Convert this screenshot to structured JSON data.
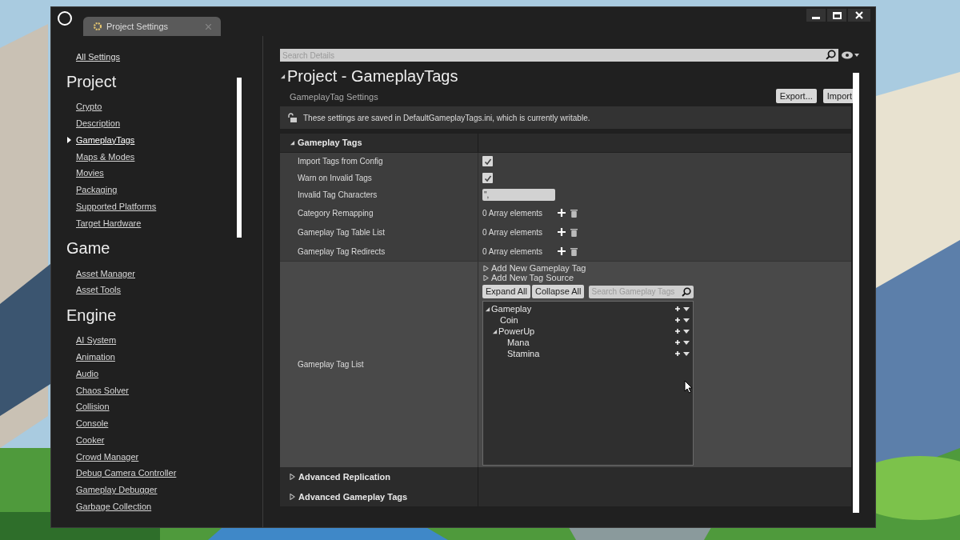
{
  "window": {
    "tab": "Project Settings"
  },
  "sidebar": {
    "all_settings": "All Settings",
    "sections": [
      {
        "title": "Project",
        "items": [
          {
            "label": "Crypto",
            "selected": false
          },
          {
            "label": "Description",
            "selected": false
          },
          {
            "label": "GameplayTags",
            "selected": true
          },
          {
            "label": "Maps & Modes",
            "selected": false
          },
          {
            "label": "Movies",
            "selected": false
          },
          {
            "label": "Packaging",
            "selected": false
          },
          {
            "label": "Supported Platforms",
            "selected": false
          },
          {
            "label": "Target Hardware",
            "selected": false
          }
        ]
      },
      {
        "title": "Game",
        "items": [
          {
            "label": "Asset Manager",
            "selected": false
          },
          {
            "label": "Asset Tools",
            "selected": false
          }
        ]
      },
      {
        "title": "Engine",
        "items": [
          {
            "label": "AI System",
            "selected": false
          },
          {
            "label": "Animation",
            "selected": false
          },
          {
            "label": "Audio",
            "selected": false
          },
          {
            "label": "Chaos Solver",
            "selected": false
          },
          {
            "label": "Collision",
            "selected": false
          },
          {
            "label": "Console",
            "selected": false
          },
          {
            "label": "Cooker",
            "selected": false
          },
          {
            "label": "Crowd Manager",
            "selected": false
          },
          {
            "label": "Debug Camera Controller",
            "selected": false
          },
          {
            "label": "Gameplay Debugger",
            "selected": false
          },
          {
            "label": "Garbage Collection",
            "selected": false
          }
        ]
      }
    ]
  },
  "details": {
    "search": {
      "placeholder": "Search Details"
    },
    "title": "Project - GameplayTags",
    "subtitle": "GameplayTag Settings",
    "buttons": [
      "Export...",
      "Import"
    ],
    "notice": "These settings are saved in DefaultGameplayTags.ini, which is currently writable.",
    "category": {
      "title": "Gameplay Tags",
      "expanded": true,
      "properties": [
        {
          "kind": "checkbox",
          "label": "Import Tags from Config",
          "checked": true
        },
        {
          "kind": "checkbox",
          "label": "Warn on Invalid Tags",
          "checked": true
        },
        {
          "kind": "text",
          "label": "Invalid Tag Characters",
          "value": "\","
        },
        {
          "kind": "array",
          "label": "Category Remapping",
          "value": "0 Array elements"
        },
        {
          "kind": "array",
          "label": "Gameplay Tag Table List",
          "value": "0 Array elements"
        },
        {
          "kind": "array",
          "label": "Gameplay Tag Redirects",
          "value": "0 Array elements"
        },
        {
          "kind": "taglist",
          "label": "Gameplay Tag List"
        }
      ]
    },
    "tag_list": {
      "add_rows": [
        "Add New Gameplay Tag",
        "Add New Tag Source"
      ],
      "buttons": [
        "Expand All",
        "Collapse All"
      ],
      "search": {
        "placeholder": "Search Gameplay Tags"
      },
      "tree": [
        {
          "label": "Gameplay",
          "expanded": true,
          "children": [
            {
              "label": "Coin"
            },
            {
              "label": "PowerUp",
              "expanded": true,
              "children": [
                {
                  "label": "Mana"
                },
                {
                  "label": "Stamina"
                }
              ]
            }
          ]
        }
      ]
    },
    "collapsed_categories": [
      {
        "title": "Advanced Replication",
        "expanded": false
      },
      {
        "title": "Advanced Gameplay Tags",
        "expanded": false
      }
    ]
  }
}
